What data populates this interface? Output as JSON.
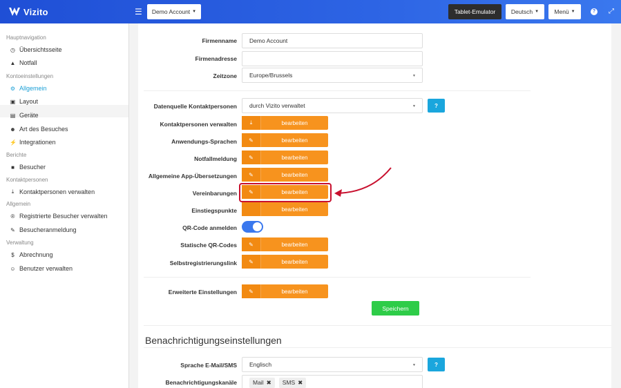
{
  "header": {
    "brand": "Vizito",
    "account_label": "Demo Account",
    "tablet_label": "Tablet-Emulator",
    "language_label": "Deutsch",
    "menu_label": "Menü",
    "help_icon": "?"
  },
  "sidebar": {
    "sections": [
      {
        "title": "Hauptnavigation"
      },
      {
        "title": "Kontoeinstellungen"
      },
      {
        "title": "Berichte"
      },
      {
        "title": "Kontaktpersonen"
      },
      {
        "title": "Allgemein"
      },
      {
        "title": "Verwaltung"
      }
    ],
    "items": [
      {
        "label": "Übersichtsseite",
        "icon": "dashboard-icon"
      },
      {
        "label": "Notfall",
        "icon": "warning-icon"
      },
      {
        "label": "Allgemein",
        "icon": "gear-icon"
      },
      {
        "label": "Layout",
        "icon": "image-icon"
      },
      {
        "label": "Geräte",
        "icon": "devices-icon"
      },
      {
        "label": "Art des Besuches",
        "icon": "users-icon"
      },
      {
        "label": "Integrationen",
        "icon": "plug-icon"
      },
      {
        "label": "Besucher",
        "icon": "book-icon"
      },
      {
        "label": "Kontaktpersonen verwalten",
        "icon": "download-icon"
      },
      {
        "label": "Registrierte Besucher verwalten",
        "icon": "registered-icon"
      },
      {
        "label": "Besucheranmeldung",
        "icon": "pencil-icon"
      },
      {
        "label": "Abrechnung",
        "icon": "dollar-icon"
      },
      {
        "label": "Benutzer verwalten",
        "icon": "user-plus-icon"
      }
    ]
  },
  "form": {
    "firmenname_label": "Firmenname",
    "firmenname_value": "Demo Account",
    "firmenadresse_label": "Firmenadresse",
    "firmenadresse_value": "",
    "zeitzone_label": "Zeitzone",
    "zeitzone_value": "Europe/Brussels",
    "datenquelle_label": "Datenquelle Kontaktpersonen",
    "datenquelle_value": "durch Vizito verwaltet",
    "rows": [
      {
        "label": "Kontaktpersonen verwalten",
        "button": "bearbeiten",
        "icon": "download-icon"
      },
      {
        "label": "Anwendungs-Sprachen",
        "button": "bearbeiten",
        "icon": "edit-icon"
      },
      {
        "label": "Notfallmeldung",
        "button": "bearbeiten",
        "icon": "edit-icon"
      },
      {
        "label": "Allgemeine App-Übersetzungen",
        "button": "bearbeiten",
        "icon": "edit-icon"
      },
      {
        "label": "Vereinbarungen",
        "button": "bearbeiten",
        "icon": "edit-icon"
      },
      {
        "label": "Einstiegspunkte",
        "button": "bearbeiten",
        "icon": "none"
      }
    ],
    "qr_label": "QR-Code anmelden",
    "qr_enabled": true,
    "rows2": [
      {
        "label": "Statische QR-Codes",
        "button": "bearbeiten",
        "icon": "edit-icon"
      },
      {
        "label": "Selbstregistrierungslink",
        "button": "bearbeiten",
        "icon": "edit-icon"
      }
    ],
    "advanced_label": "Erweiterte Einstellungen",
    "advanced_button": "bearbeiten",
    "save_label": "Speichern"
  },
  "notifications": {
    "title": "Benachrichtigungseinstellungen",
    "language_label": "Sprache E-Mail/SMS",
    "language_value": "Englisch",
    "channels_label": "Benachrichtigungskanäle",
    "channels": [
      "Mail",
      "SMS"
    ]
  },
  "colors": {
    "topbar": "#2d64e4",
    "accent_orange": "#f7931e",
    "help_blue": "#1aa6dd",
    "save_green": "#2ecc48",
    "highlight_red": "#c8102e"
  }
}
